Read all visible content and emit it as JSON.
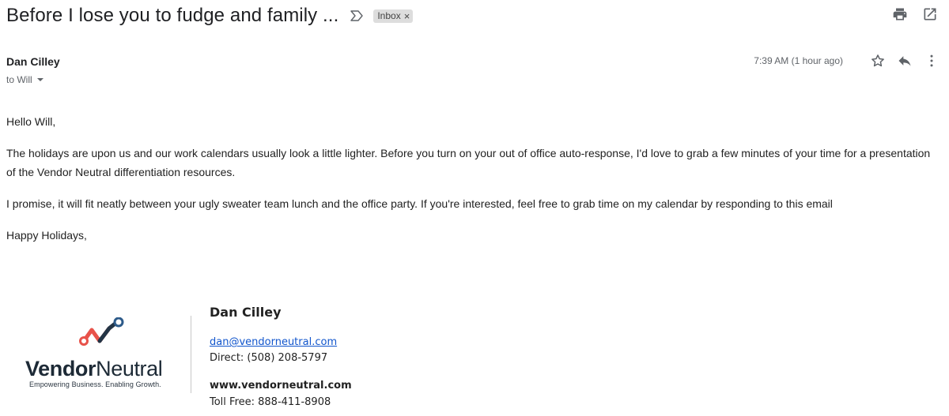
{
  "email": {
    "subject": "Before I lose you to fudge and family ...",
    "label": "Inbox",
    "label_remove": "×",
    "sender_name": "Dan Cilley",
    "recipient": "to Will",
    "timestamp": "7:39 AM (1 hour ago)",
    "body": [
      "Hello Will,",
      "The holidays are upon us and our work calendars usually look a little lighter. Before you turn on your out of office auto-response, I'd love to grab a few minutes of your time for a presentation of the Vendor Neutral differentiation resources.",
      "I promise, it will fit neatly between your ugly sweater team lunch and the office party. If you're interested, feel free to grab time on my calendar by responding to this email",
      "Happy Holidays,"
    ]
  },
  "signature": {
    "logo_text_bold": "Vendor",
    "logo_text_regular": "Neutral",
    "logo_tagline": "Empowering Business. Enabling Growth.",
    "name": "Dan Cilley",
    "email": "dan@vendorneutral.com",
    "direct": "Direct: (508) 208-5797",
    "website": "www.vendorneutral.com",
    "toll_free": "Toll Free: 888-411-8908"
  },
  "icons": {
    "important": "important-marker-icon",
    "print": "print-icon",
    "open_new_window": "open-in-new-window-icon",
    "star": "star-icon",
    "reply": "reply-icon",
    "more": "more-vert-icon"
  },
  "colors": {
    "link": "#1155cc",
    "logo_red": "#e8524a",
    "logo_navy": "#233445",
    "logo_blue": "#2d5b8a"
  }
}
